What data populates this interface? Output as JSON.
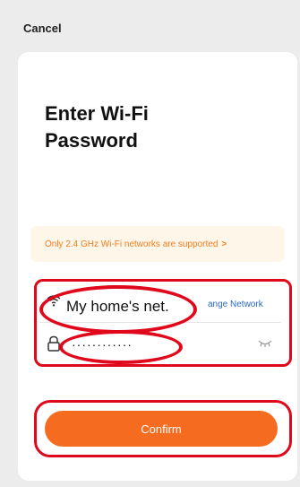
{
  "header": {
    "cancel_label": "Cancel"
  },
  "page": {
    "title": "Enter Wi-Fi Password"
  },
  "notice": {
    "text": "Only 2.4 GHz Wi-Fi networks are supported",
    "chevron": ">"
  },
  "network": {
    "icon": "wifi-icon",
    "name": "My home's net.",
    "change_label": "ange Network"
  },
  "password": {
    "icon": "lock-icon",
    "value": "············",
    "visibility_icon": "eye-closed-icon"
  },
  "actions": {
    "confirm_label": "Confirm"
  },
  "colors": {
    "accent": "#f56b1f",
    "notice_text": "#f07d1e",
    "notice_bg": "#fff6ea",
    "link": "#2a66c8",
    "annotation": "#e0081b"
  }
}
